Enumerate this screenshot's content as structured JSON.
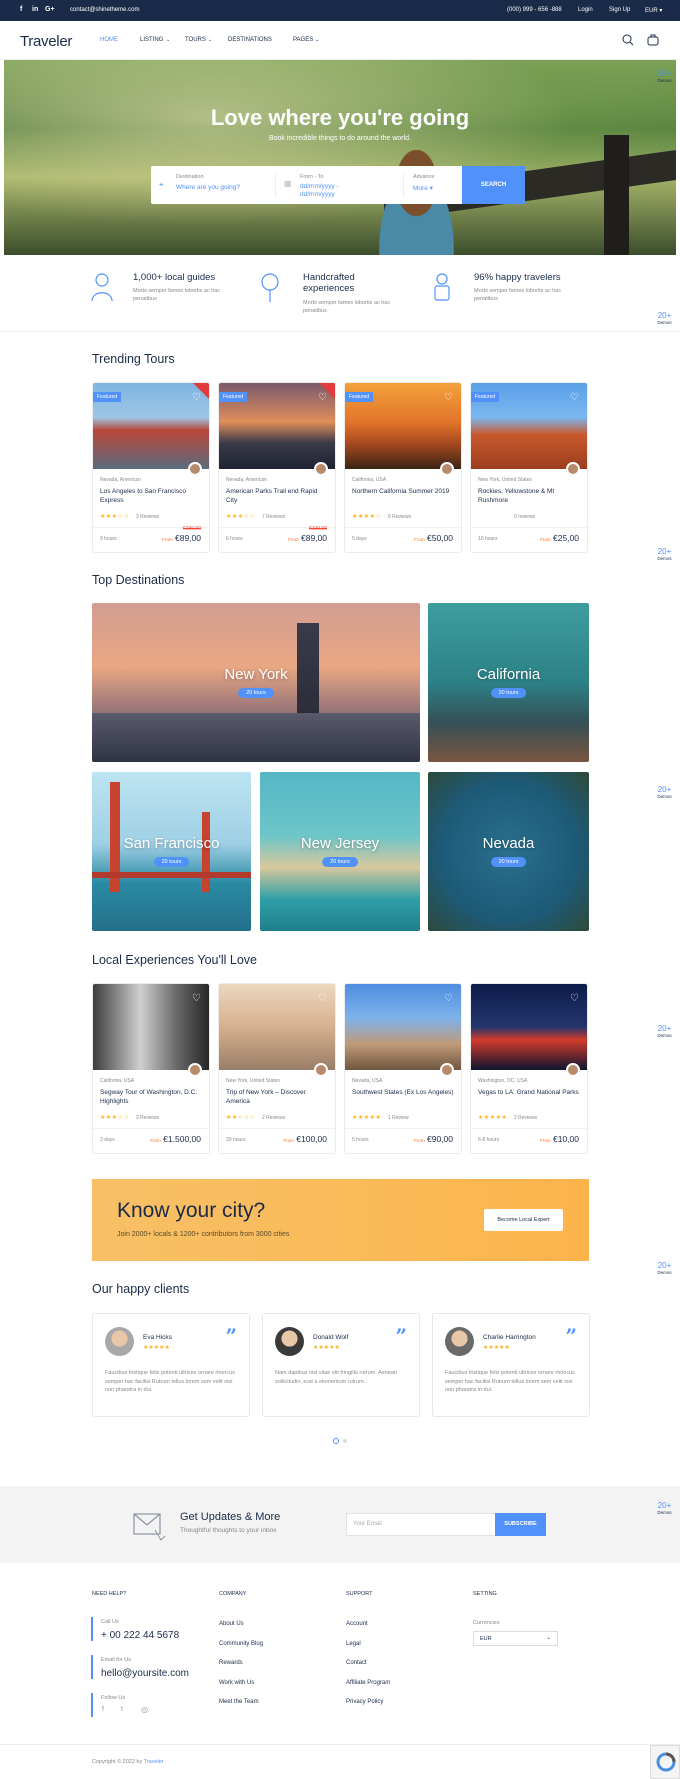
{
  "topbar": {
    "email": "contact@shinetheme.com",
    "phone": "(000) 999 - 656 -888",
    "login": "Login",
    "signup": "Sign Up",
    "currency": "EUR ▾"
  },
  "nav": {
    "logo": "Traveler",
    "items": [
      "HOME",
      "LISTING",
      "TOURS",
      "DESTINATIONS",
      "PAGES"
    ]
  },
  "hero": {
    "title": "Love where you're going",
    "subtitle": "Book incredible things to do around the world.",
    "dest_label": "Destination",
    "dest_placeholder": "Where are you going?",
    "date_label": "From - To",
    "date_value": "dd/mm/yyyy - dd/mm/yyyy",
    "adv_label": "Advance",
    "adv_value": "More ▾",
    "search": "SEARCH"
  },
  "features": [
    {
      "title": "1,000+ local guides",
      "desc": "Morbi semper fames lobortis ac hac penatibus"
    },
    {
      "title": "Handcrafted experiences",
      "desc": "Morbi semper fames lobortis ac hac penatibus"
    },
    {
      "title": "96% happy travelers",
      "desc": "Morbi semper fames lobortis ac hac penatibus"
    }
  ],
  "trending": {
    "title": "Trending Tours",
    "badge": "Featured",
    "cards": [
      {
        "loc": "Nevada, American",
        "title": "Los Angeles to San Francisco Express",
        "stars": "★★★☆☆",
        "reviews": "3 Reviews",
        "dur": "9 hours",
        "old": "€100,00",
        "from": "From",
        "price": "€89,00",
        "hot": "HOT"
      },
      {
        "loc": "Nevada, American",
        "title": "American Parks Trail end Rapid City",
        "stars": "★★★☆☆",
        "reviews": "7 Reviews",
        "dur": "6 hours",
        "old": "€100,00",
        "from": "From",
        "price": "€89,00",
        "hot": "HOT"
      },
      {
        "loc": "California, USA",
        "title": "Northern California Summer 2019",
        "stars": "★★★★☆",
        "reviews": "6 Reviews",
        "dur": "5 days",
        "old": "",
        "from": "From",
        "price": "€50,00",
        "hot": ""
      },
      {
        "loc": "New York, United States",
        "title": "Rockies, Yellowstone & Mt Rushmore",
        "stars": "",
        "reviews": "0 reviews",
        "dur": "10 hours",
        "old": "",
        "from": "From",
        "price": "€25,00",
        "hot": ""
      }
    ]
  },
  "destinations": {
    "title": "Top Destinations",
    "items": [
      {
        "name": "New York",
        "tours": "20 tours"
      },
      {
        "name": "California",
        "tours": "20 tours"
      },
      {
        "name": "San Francisco",
        "tours": "20 tours"
      },
      {
        "name": "New Jersey",
        "tours": "20 tours"
      },
      {
        "name": "Nevada",
        "tours": "20 tours"
      }
    ]
  },
  "experiences": {
    "title": "Local Experiences You'll Love",
    "cards": [
      {
        "loc": "California, USA",
        "title": "Segway Tour of Washington, D.C. Highlights",
        "stars": "★★★☆☆",
        "reviews": "2 Reviews",
        "dur": "3 days",
        "from": "From",
        "price": "€1.500,00"
      },
      {
        "loc": "New York, United States",
        "title": "Trip of New York – Discover America",
        "stars": "★★☆☆☆",
        "reviews": "2 Reviews",
        "dur": "20 hours",
        "from": "From",
        "price": "€100,00"
      },
      {
        "loc": "Nevada, USA",
        "title": "Southwest States (Ex Los Angeles)",
        "stars": "★★★★★",
        "reviews": "1 Review",
        "dur": "5 hours",
        "from": "From",
        "price": "€90,00"
      },
      {
        "loc": "Washington, DC, USA",
        "title": "Vegas to LA: Grand National Parks",
        "stars": "★★★★★",
        "reviews": "2 Reviews",
        "dur": "6-8 hours",
        "from": "From",
        "price": "€10,00"
      }
    ]
  },
  "cta": {
    "title": "Know your city?",
    "sub": "Join 2000+ locals & 1200+ contributors from 3000 cities",
    "button": "Become Local Expert"
  },
  "clients": {
    "title": "Our happy clients",
    "items": [
      {
        "name": "Eva Hicks",
        "stars": "★★★★★",
        "text": "Faucibus tristique felis potenti ultrices ornare rhoncus semper hac facilisi Rutrum tellus lorem sem velit nisi non pharetra in dui."
      },
      {
        "name": "Donald Wolf",
        "stars": "★★★★★",
        "text": "Nam dapibus nisl vitae elit fringilla rutrum. Aenean sollicitudin, erat a elementum rutrum."
      },
      {
        "name": "Charlie Harrington",
        "stars": "★★★★★",
        "text": "Faucibus tristique felis potenti ultrices ornare rhoncus semper hac facilisi Rutrum tellus lorem sem velit nisi non pharetra in dui."
      }
    ]
  },
  "newsletter": {
    "title": "Get Updates & More",
    "sub": "Thoughtful thoughts to your inbox",
    "placeholder": "Your Email",
    "button": "SUBSCRIBE"
  },
  "footer": {
    "need_help": "NEED HELP?",
    "call_label": "Call Us",
    "phone": "+ 00 222 44 5678",
    "email_label": "Email for Us",
    "email": "hello@yoursite.com",
    "follow": "Follow Us",
    "company": "COMPANY",
    "company_links": [
      "About Us",
      "Community Blog",
      "Rewards",
      "Work with Us",
      "Meet the Team"
    ],
    "support": "SUPPORT",
    "support_links": [
      "Account",
      "Legal",
      "Contact",
      "Affiliate Program",
      "Privacy Policy"
    ],
    "setting": "SETTING",
    "currencies": "Currencies",
    "currency": "EUR",
    "copyright": "Copyright © 2022 by",
    "brand": "Traveler"
  },
  "demos": {
    "num": "20+",
    "label": "Demos"
  },
  "colors": {
    "accent": "#5191fa",
    "navy": "#1a2b49",
    "star": "#fab320",
    "cta": "#fdb44c"
  }
}
